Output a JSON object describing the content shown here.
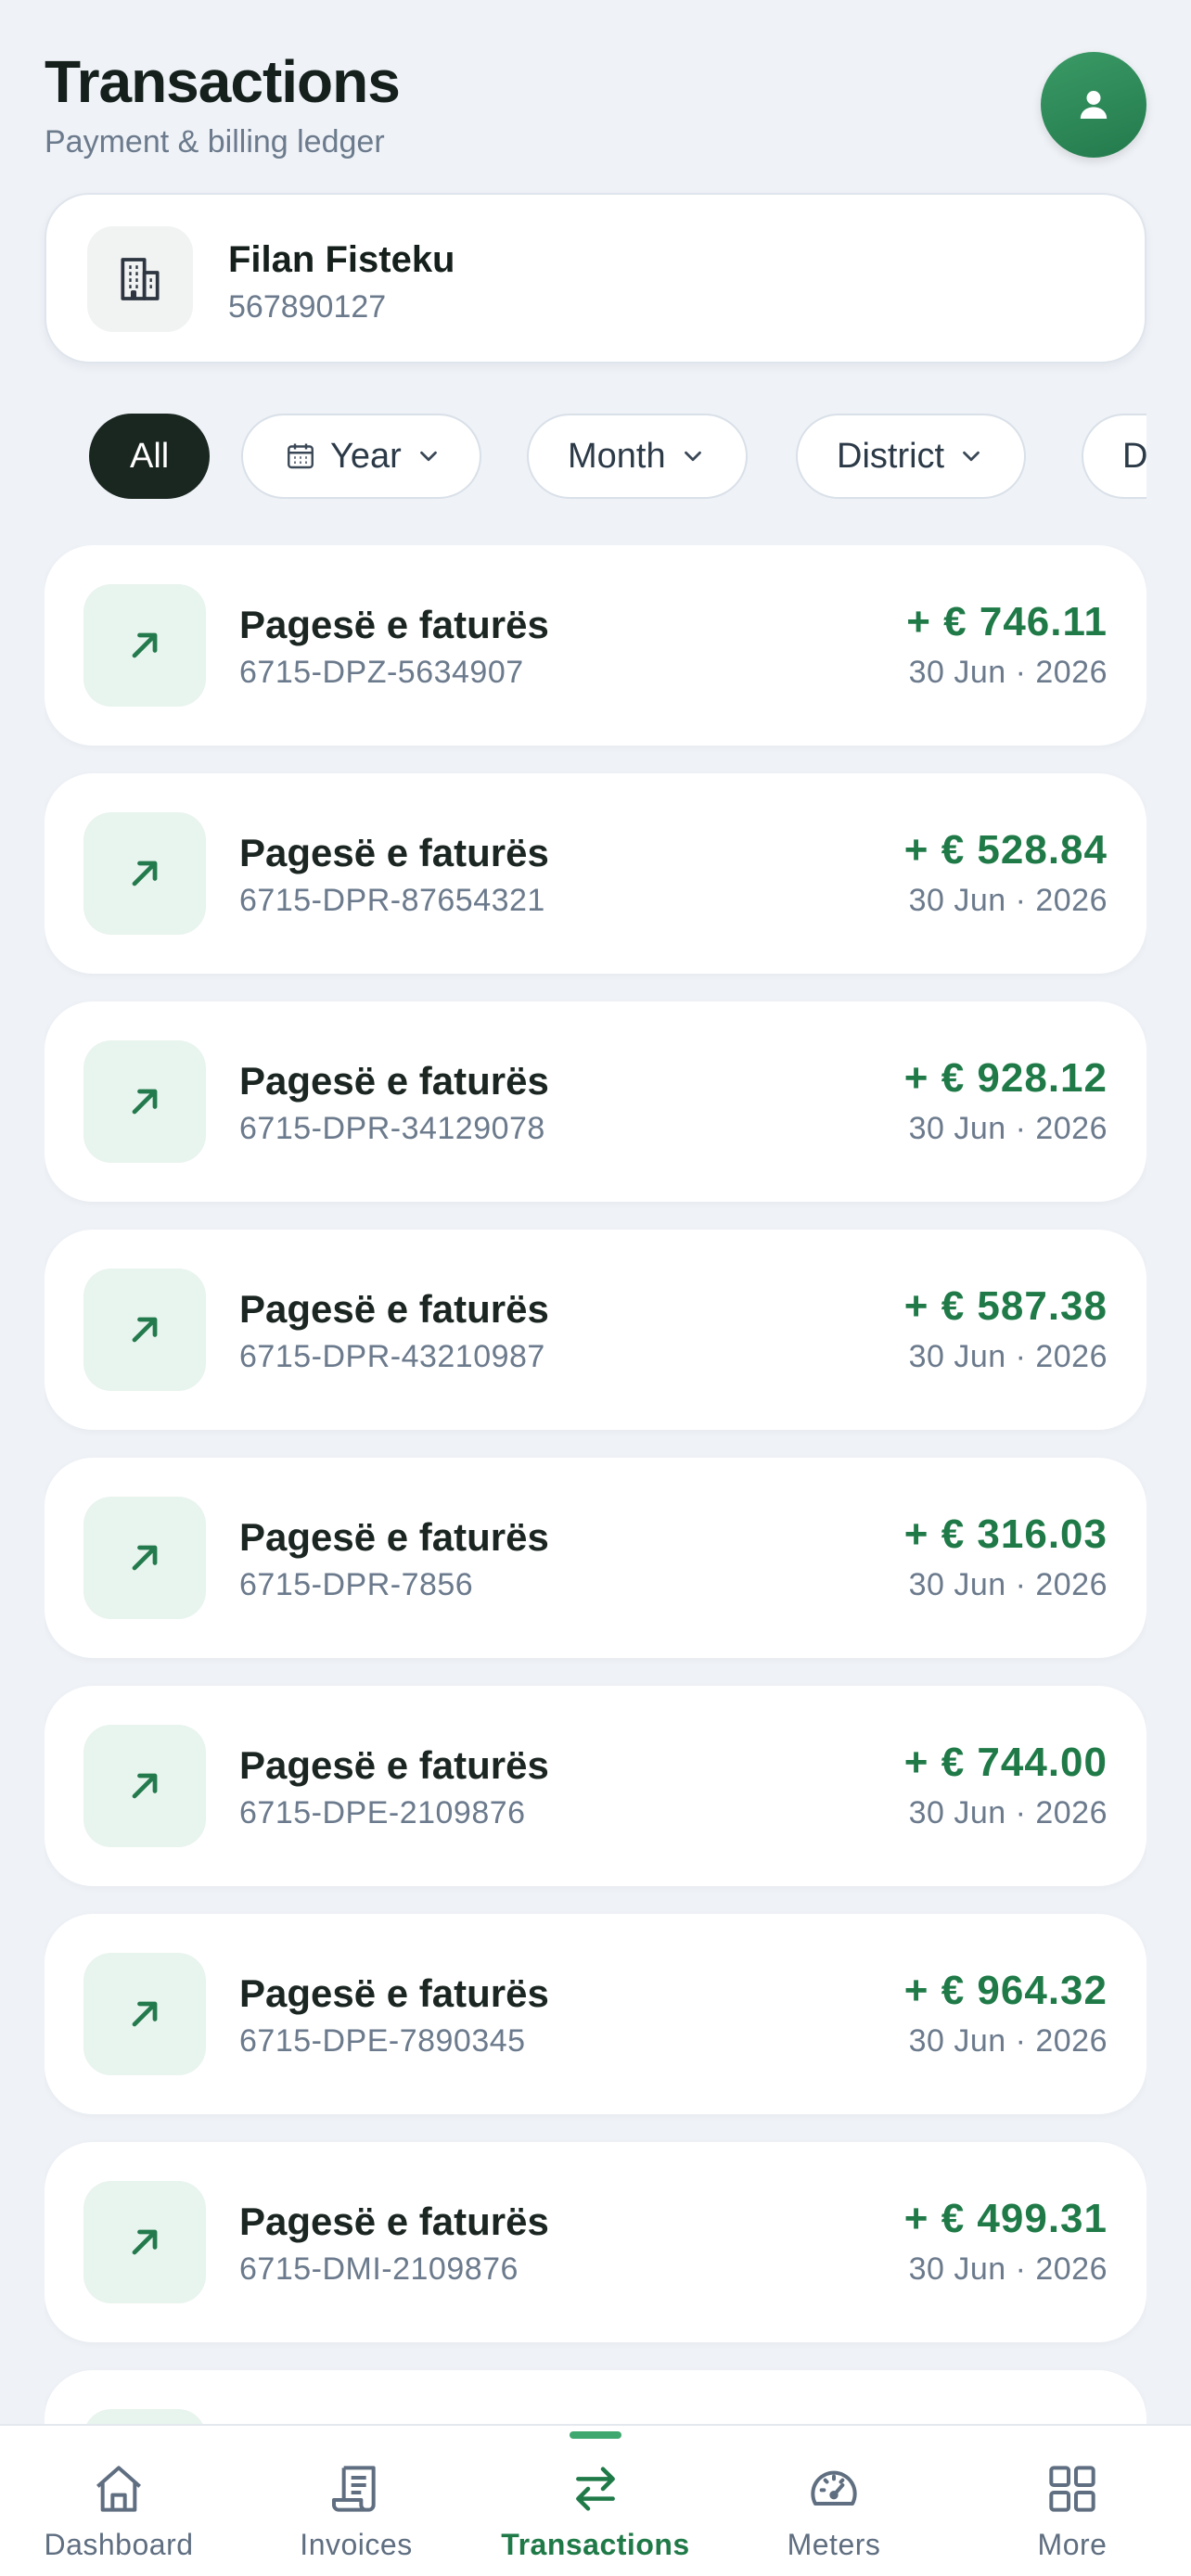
{
  "header": {
    "title": "Transactions",
    "subtitle": "Payment & billing ledger"
  },
  "account": {
    "name": "Filan Fisteku",
    "id": "567890127",
    "icon": "building-icon"
  },
  "filters": [
    {
      "label": "All",
      "active": true
    },
    {
      "label": "Year",
      "icon": "calendar-icon"
    },
    {
      "label": "Month"
    },
    {
      "label": "District"
    },
    {
      "label": "D"
    }
  ],
  "transactions": [
    {
      "title": "Pagesë e faturës",
      "ref": "6715-DPZ-5634907",
      "amount": "+ € 746.11",
      "date": "30 Jun · 2026"
    },
    {
      "title": "Pagesë e faturës",
      "ref": "6715-DPR-87654321",
      "amount": "+ € 528.84",
      "date": "30 Jun · 2026"
    },
    {
      "title": "Pagesë e faturës",
      "ref": "6715-DPR-34129078",
      "amount": "+ € 928.12",
      "date": "30 Jun · 2026"
    },
    {
      "title": "Pagesë e faturës",
      "ref": "6715-DPR-43210987",
      "amount": "+ € 587.38",
      "date": "30 Jun · 2026"
    },
    {
      "title": "Pagesë e faturës",
      "ref": "6715-DPR-7856",
      "amount": "+ € 316.03",
      "date": "30 Jun · 2026"
    },
    {
      "title": "Pagesë e faturës",
      "ref": "6715-DPE-2109876",
      "amount": "+ € 744.00",
      "date": "30 Jun · 2026"
    },
    {
      "title": "Pagesë e faturës",
      "ref": "6715-DPE-7890345",
      "amount": "+ € 964.32",
      "date": "30 Jun · 2026"
    },
    {
      "title": "Pagesë e faturës",
      "ref": "6715-DMI-2109876",
      "amount": "+ € 499.31",
      "date": "30 Jun · 2026"
    }
  ],
  "tabbar": [
    {
      "label": "Dashboard",
      "icon": "home-icon"
    },
    {
      "label": "Invoices",
      "icon": "receipt-icon"
    },
    {
      "label": "Transactions",
      "icon": "transfer-icon",
      "active": true
    },
    {
      "label": "Meters",
      "icon": "gauge-icon"
    },
    {
      "label": "More",
      "icon": "grid-icon"
    }
  ],
  "colors": {
    "accent": "#1f7a48",
    "background": "#eff2f7",
    "active_chip": "#1a2620"
  }
}
